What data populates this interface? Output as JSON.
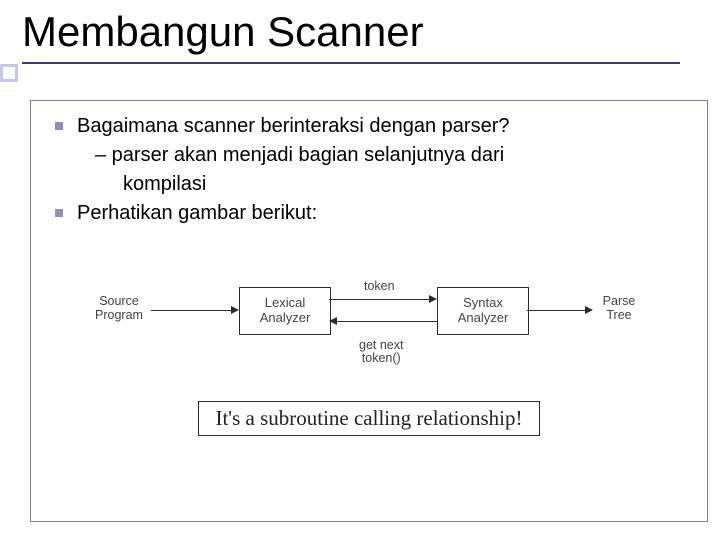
{
  "title": "Membangun Scanner",
  "bullets": {
    "item1": {
      "text": "Bagaimana  scanner berinteraksi dengan  parser?",
      "sub1": "– parser akan menjadi bagian selanjutnya dari",
      "sub1b": "kompilasi"
    },
    "item2": {
      "text": "Perhatikan gambar berikut:"
    }
  },
  "diagram": {
    "source": "Source\nProgram",
    "lex": "Lexical\nAnalyzer",
    "syn": "Syntax\nAnalyzer",
    "parse": "Parse\nTree",
    "token": "token",
    "getnext": "get next\ntoken()"
  },
  "caption": "It's a subroutine calling relationship!"
}
